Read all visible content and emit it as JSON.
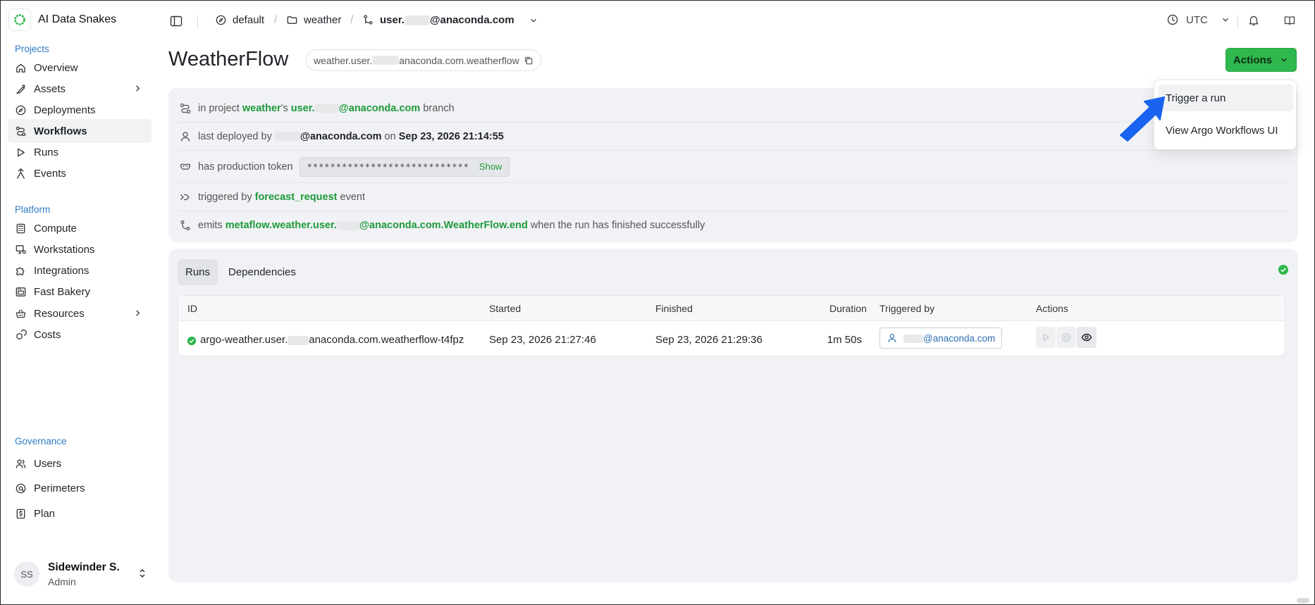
{
  "app": {
    "name": "AI Data Snakes",
    "accent": "#2fb84d",
    "link_blue": "#2e7bc4"
  },
  "sidebar": {
    "sections": [
      {
        "label": "Projects",
        "items": [
          {
            "label": "Overview",
            "icon": "home-icon"
          },
          {
            "label": "Assets",
            "icon": "brush-icon",
            "has_submenu": true
          },
          {
            "label": "Deployments",
            "icon": "compass-icon"
          },
          {
            "label": "Workflows",
            "icon": "workflow-icon",
            "active": true
          },
          {
            "label": "Runs",
            "icon": "play-icon"
          },
          {
            "label": "Events",
            "icon": "event-icon"
          }
        ]
      },
      {
        "label": "Platform",
        "items": [
          {
            "label": "Compute",
            "icon": "calculator-icon"
          },
          {
            "label": "Workstations",
            "icon": "monitor-icon"
          },
          {
            "label": "Integrations",
            "icon": "puzzle-icon"
          },
          {
            "label": "Fast Bakery",
            "icon": "oven-icon"
          },
          {
            "label": "Resources",
            "icon": "basket-icon",
            "has_submenu": true
          },
          {
            "label": "Costs",
            "icon": "coins-icon"
          }
        ]
      },
      {
        "label": "Governance",
        "items": [
          {
            "label": "Users",
            "icon": "users-icon"
          },
          {
            "label": "Perimeters",
            "icon": "perimeter-icon"
          },
          {
            "label": "Plan",
            "icon": "dollar-icon"
          }
        ]
      }
    ],
    "user": {
      "initials": "SS",
      "name": "Sidewinder S.",
      "role": "Admin"
    }
  },
  "topbar": {
    "breadcrumb": {
      "perimeter": "default",
      "project": "weather",
      "branch_prefix": "user.",
      "branch_suffix": "@anaconda.com"
    },
    "timezone": "UTC"
  },
  "header": {
    "title": "WeatherFlow",
    "flow_id_prefix": "weather.user.",
    "flow_id_suffix": "anaconda.com.weatherflow",
    "actions_label": "Actions"
  },
  "info": {
    "project_pre": "in project",
    "project": "weather",
    "project_possessive": "'s",
    "branch_prefix": "user.",
    "branch_suffix": "@anaconda.com",
    "branch_word": "branch",
    "deployed_pre": "last deployed by",
    "deployed_by_suffix": "@anaconda.com",
    "deployed_on": "on",
    "deployed_at": "Sep 23, 2026 21:14:55",
    "token_pre": "has production token",
    "token_mask": "****************************",
    "token_show": "Show",
    "trigger_pre": "triggered by",
    "trigger_event": "forecast_request",
    "trigger_post": "event",
    "emits_pre": "emits",
    "emits_prefix": "metaflow.weather.user.",
    "emits_suffix": "@anaconda.com.WeatherFlow.end",
    "emits_post": "when the run has finished successfully"
  },
  "runs": {
    "tabs": [
      "Runs",
      "Dependencies"
    ],
    "columns": [
      "ID",
      "Started",
      "Finished",
      "Duration",
      "Triggered by",
      "Actions"
    ],
    "rows": [
      {
        "status": "success",
        "id_prefix": "argo-weather.user.",
        "id_suffix": "anaconda.com.weatherflow-t4fpz",
        "started": "Sep 23, 2026 21:27:46",
        "finished": "Sep 23, 2026 21:29:36",
        "duration": "1m 50s",
        "triggered_by_suffix": "@anaconda.com"
      }
    ]
  },
  "dropdown": {
    "items": [
      "Trigger a run",
      "View Argo Workflows UI"
    ]
  }
}
